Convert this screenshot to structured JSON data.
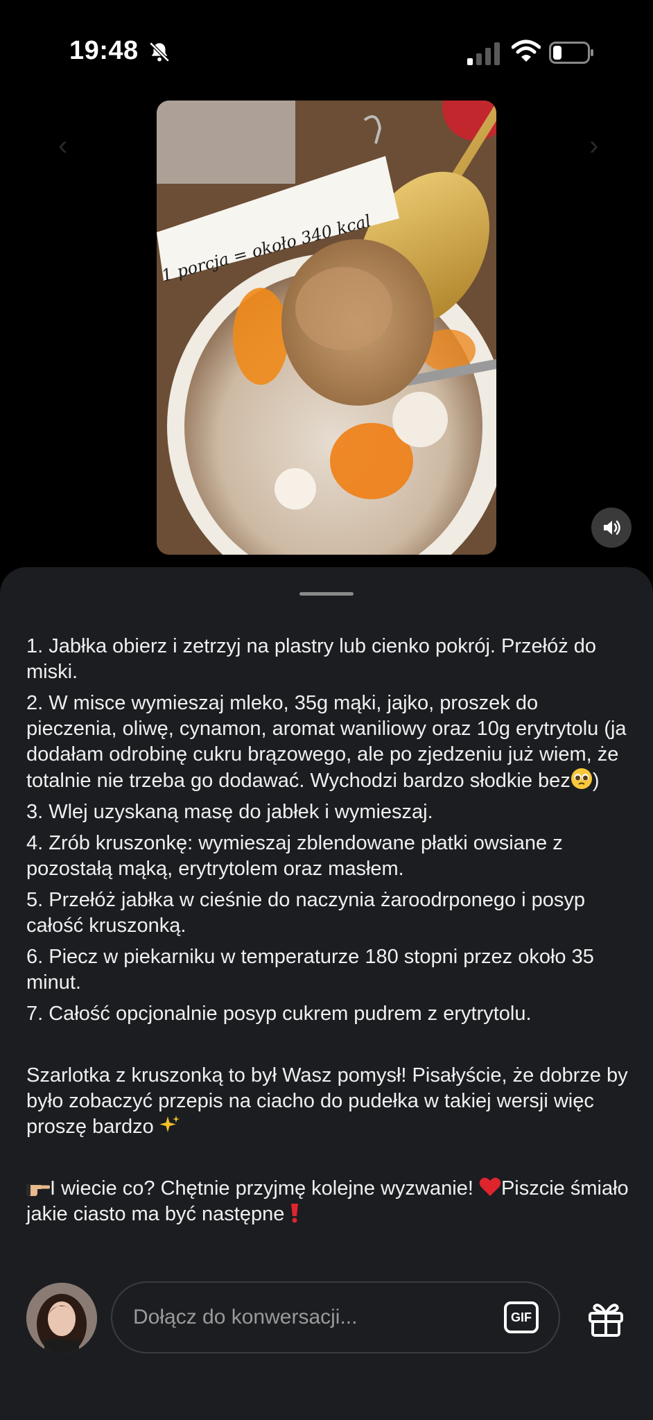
{
  "status_bar": {
    "time": "19:48",
    "icons": [
      "bell-slash-icon",
      "signal-icon",
      "wifi-icon",
      "battery-icon"
    ]
  },
  "video": {
    "note_text": "1 porcja = około 340 kcal",
    "sound_icon": "speaker-icon"
  },
  "description": {
    "steps": [
      "1. Jabłka obierz i zetrzyj na plastry lub cienko pokrój. Przełóż do miski.",
      "2. W misce wymieszaj mleko, 35g mąki, jajko, proszek do pieczenia, oliwę, cynamon, aromat waniliowy oraz 10g erytrytolu (ja dodałam odrobinę cukru brązowego, ale po zjedzeniu już wiem, że totalnie nie trzeba go dodawać. Wychodzi bardzo słodkie bez",
      "3. Wlej uzyskaną masę do jabłek i wymieszaj.",
      "4. Zrób kruszonkę: wymieszaj zblendowane płatki owsiane z pozostałą mąką, erytrytolem oraz masłem.",
      "5. Przełóż jabłka w cieśnie do naczynia żaroodrponego i posyp całość kruszonką.",
      "6. Piecz w piekarniku w temperaturze 180 stopni przez około 35 minut.",
      "7. Całość opcjonalnie posyp cukrem pudrem z erytrytolu."
    ],
    "step2_suffix": ")",
    "para1": "Szarlotka z kruszonką to był Wasz pomysł! Pisałyście, że dobrze by było zobaczyć przepis na ciacho do pudełka w takiej wersji więc proszę bardzo",
    "para2_a": "I wiecie co? Chętnie przyjmę kolejne wyzwanie!",
    "para2_b": "Piszcie śmiało jakie ciasto ma być następne"
  },
  "comment_bar": {
    "placeholder": "Dołącz do konwersacji...",
    "gif_label": "GIF"
  },
  "colors": {
    "sheet_bg": "#1b1d21",
    "text": "#f0f0f0",
    "heart": "#e0242e"
  }
}
